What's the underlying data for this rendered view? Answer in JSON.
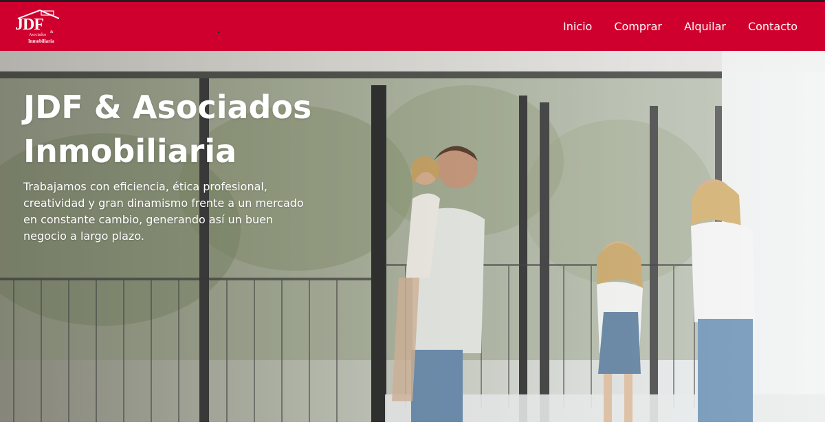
{
  "header": {
    "logo": {
      "main": "JDF",
      "amp": "&",
      "line1": "Asociados",
      "line2": "Inmobiliaria"
    },
    "nav": [
      "Inicio",
      "Comprar",
      "Alquilar",
      "Contacto"
    ]
  },
  "hero": {
    "title_line1": "JDF & Asociados",
    "title_line2": "Inmobiliaria",
    "text": "Trabajamos con eficiencia, ética profesional, creatividad y gran  dinamismo frente a un mercado en constante cambio, generando así un buen  negocio a largo plazo."
  },
  "colors": {
    "brand": "#d0002e",
    "topline": "#2a1a24",
    "text_on_brand": "#ffffff"
  }
}
